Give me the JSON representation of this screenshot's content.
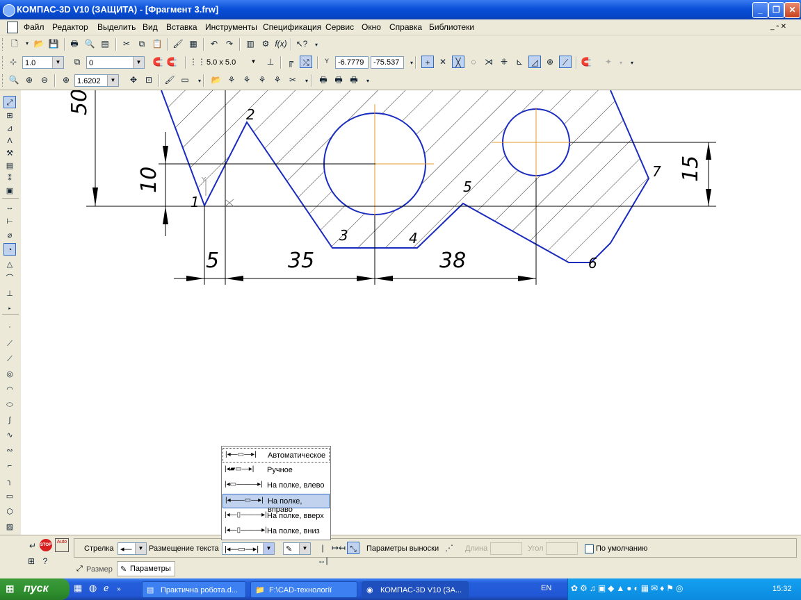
{
  "window": {
    "title": "КОМПАС-3D V10 (ЗАЩИТА) - [Фрагмент 3.frw]",
    "minimize_icon": "minimize-icon",
    "restore_icon": "restore-icon",
    "close_icon": "close-icon"
  },
  "menu": {
    "items": [
      "Файл",
      "Редактор",
      "Выделить",
      "Вид",
      "Вставка",
      "Инструменты",
      "Спецификация",
      "Сервис",
      "Окно",
      "Справка",
      "Библиотеки"
    ]
  },
  "toolbar2": {
    "style_value": "1.0",
    "layer_value": "0",
    "grid_value": "5.0 x 5.0",
    "x_value": "-6.7779",
    "y_value": "-75.537"
  },
  "toolbar3": {
    "zoom_value": "1.6202"
  },
  "drawing": {
    "dimension_labels": {
      "d50": "50",
      "d10": "10",
      "d15": "15",
      "d5": "5",
      "d35": "35",
      "d38": "38"
    },
    "point_labels": [
      "1",
      "2",
      "3",
      "4",
      "5",
      "6",
      "7"
    ],
    "axis_label": "Y"
  },
  "dropdown": {
    "items": [
      {
        "label": "Автоматическое",
        "selected": false
      },
      {
        "label": "Ручное",
        "selected": false
      },
      {
        "label": "На полке, влево",
        "selected": false
      },
      {
        "label": "На полке, вправо",
        "selected": true
      },
      {
        "label": "На полке, вверх",
        "selected": false
      },
      {
        "label": "На полке, вниз",
        "selected": false
      }
    ]
  },
  "propbar": {
    "arrow_label": "Стрелка",
    "placement_label": "Размещение текста",
    "leader_params_label": "Параметры выноски",
    "length_label": "Длина",
    "angle_label": "Угол",
    "default_label": "По умолчанию",
    "stop_label": "STOP",
    "auto_label": "Auto",
    "tabs": [
      "Размер",
      "Параметры"
    ]
  },
  "taskbar": {
    "start_label": "пуск",
    "tasks": [
      "Практична робота.d...",
      "F:\\CAD-технології",
      "КОМПАС-3D V10 (ЗА..."
    ],
    "lang": "EN",
    "clock": "15:32"
  }
}
